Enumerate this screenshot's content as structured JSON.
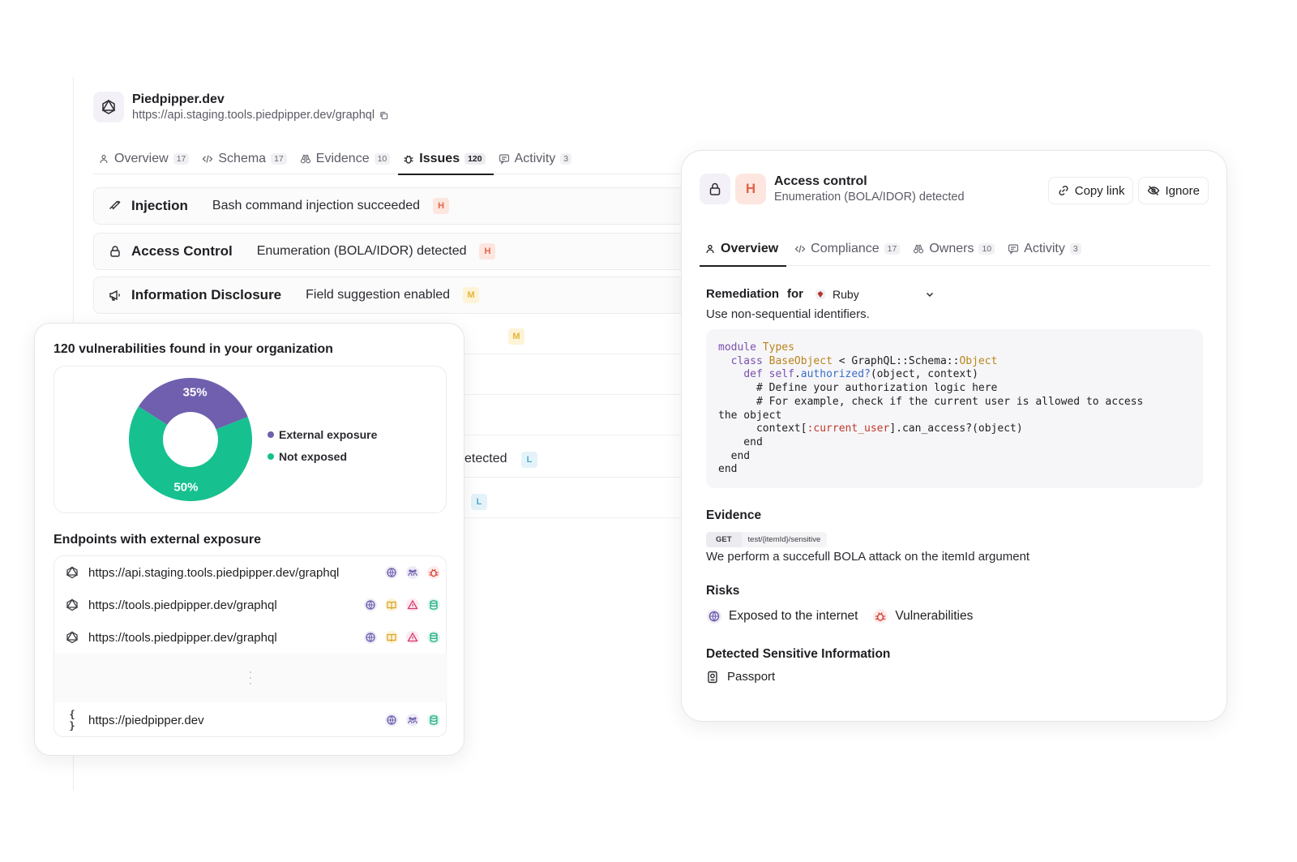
{
  "app": {
    "name": "Piedpipper.dev",
    "url": "https://api.staging.tools.piedpipper.dev/graphql",
    "tabs": [
      {
        "label": "Overview",
        "count": "17"
      },
      {
        "label": "Schema",
        "count": "17"
      },
      {
        "label": "Evidence",
        "count": "10"
      },
      {
        "label": "Issues",
        "count": "120"
      },
      {
        "label": "Activity",
        "count": "3"
      }
    ],
    "active_tab": "Issues"
  },
  "issues": [
    {
      "category": "Injection",
      "title": "Bash command injection succeeded",
      "severity": "H",
      "icon": "syringe-icon"
    },
    {
      "category": "Access Control",
      "title": "Enumeration (BOLA/IDOR) detected",
      "severity": "H",
      "icon": "lock-icon"
    },
    {
      "category": "Information Disclosure",
      "title": "Field suggestion enabled",
      "severity": "M",
      "icon": "megaphone-icon"
    }
  ],
  "partial_rows": [
    {
      "title": "",
      "severity": "M"
    },
    {
      "title": "etected",
      "severity": "L"
    },
    {
      "title": "",
      "severity": "L"
    }
  ],
  "vuln_card": {
    "title": "120 vulnerabilities found in your organization",
    "endpoints_title": "Endpoints with external exposure",
    "endpoints": [
      {
        "url": "https://api.staging.tools.piedpipper.dev/graphql",
        "type_icon": "graphql-icon",
        "icons": [
          "globe-icon",
          "users-icon",
          "bug-icon"
        ]
      },
      {
        "url": "https://tools.piedpipper.dev/graphql",
        "type_icon": "graphql-icon",
        "icons": [
          "globe-icon",
          "book-icon",
          "warning-icon",
          "database-icon"
        ]
      },
      {
        "url": "https://tools.piedpipper.dev/graphql",
        "type_icon": "graphql-icon",
        "icons": [
          "globe-icon",
          "book-icon",
          "warning-icon",
          "database-icon"
        ]
      },
      {
        "url": "https://piedpipper.dev",
        "type_icon": "braces-icon",
        "icons": [
          "globe-icon",
          "users-icon",
          "database-icon"
        ]
      }
    ]
  },
  "chart_data": {
    "type": "pie",
    "style": "donut",
    "categories": [
      "External exposure",
      "Not exposed"
    ],
    "values": [
      35,
      65
    ],
    "data_labels": [
      "35%",
      "50%"
    ],
    "colors": [
      "#6f5fae",
      "#16c18f"
    ],
    "legend": "right"
  },
  "detail": {
    "category": "Access control",
    "title": "Enumeration (BOLA/IDOR) detected",
    "severity": "H",
    "copy_link_label": "Copy link",
    "ignore_label": "Ignore",
    "tabs": [
      {
        "label": "Overview",
        "count": ""
      },
      {
        "label": "Compliance",
        "count": "17"
      },
      {
        "label": "Owners",
        "count": "10"
      },
      {
        "label": "Activity",
        "count": "3"
      }
    ],
    "active_tab": "Overview",
    "remediation_label": "Remediation",
    "for_label": "for",
    "language": "Ruby",
    "remediation_text": "Use non-sequential identifiers.",
    "code": [
      "module Types",
      "  class BaseObject < GraphQL::Schema::Object",
      "    def self.authorized?(object, context)",
      "      # Define your authorization logic here",
      "      # For example, check if the current user is allowed to access",
      "the object",
      "      context[:current_user].can_access?(object)",
      "    end",
      "  end",
      "end"
    ],
    "evidence_heading": "Evidence",
    "evidence_method": "GET",
    "evidence_path": "test/{itemId}/sensitive",
    "evidence_text": "We perform a succefull BOLA attack on the itemId argument",
    "risks_heading": "Risks",
    "risks": [
      {
        "label": "Exposed to the internet",
        "icon": "globe-icon"
      },
      {
        "label": "Vulnerabilities",
        "icon": "bug-icon"
      }
    ],
    "sensitive_heading": "Detected Sensitive Information",
    "sensitive_items": [
      {
        "label": "Passport",
        "icon": "passport-icon"
      }
    ]
  },
  "colors": {
    "accent_purple": "#6f5fae",
    "accent_green": "#16c18f",
    "severity_high": "#e0664a",
    "severity_medium": "#e7b43b",
    "severity_low": "#4fa8d2"
  }
}
